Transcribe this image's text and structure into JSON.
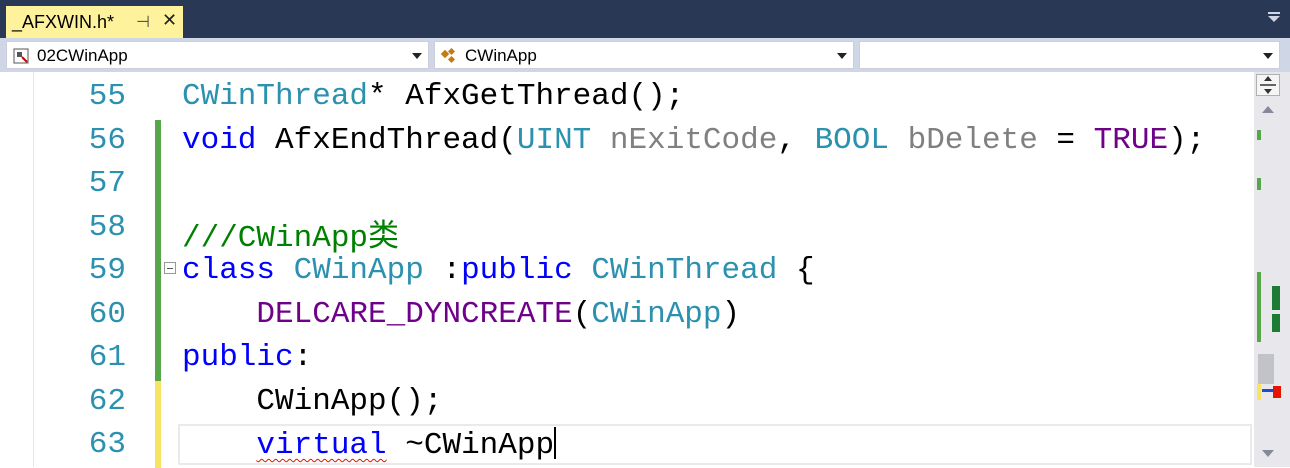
{
  "tab": {
    "title": "_AFXWIN.h*",
    "pin_glyph": "⊣",
    "close_glyph": "✕"
  },
  "nav": {
    "project_combo": "02CWinApp",
    "type_combo": "CWinApp",
    "member_combo": ""
  },
  "colors": {
    "tab_bg": "#fff29d",
    "tabstrip_bg": "#293955",
    "keyword": "#0000ff",
    "type": "#2b91af",
    "macro": "#6f008a",
    "comment": "#008000",
    "parameter": "#808080",
    "line_number": "#2b91af",
    "change_saved": "#57a64a",
    "change_unsaved": "#f7e463"
  },
  "lines": [
    {
      "number": "55",
      "change": "none",
      "outline": false,
      "tokens": [
        {
          "t": "CWinThread",
          "c": "type"
        },
        {
          "t": "* AfxGetThread();",
          "c": "plain"
        }
      ]
    },
    {
      "number": "56",
      "change": "saved",
      "outline": false,
      "tokens": [
        {
          "t": "void",
          "c": "keyword"
        },
        {
          "t": " AfxEndThread(",
          "c": "plain"
        },
        {
          "t": "UINT",
          "c": "type"
        },
        {
          "t": " ",
          "c": "plain"
        },
        {
          "t": "nExitCode",
          "c": "parameter"
        },
        {
          "t": ", ",
          "c": "plain"
        },
        {
          "t": "BOOL",
          "c": "type"
        },
        {
          "t": " ",
          "c": "plain"
        },
        {
          "t": "bDelete",
          "c": "parameter"
        },
        {
          "t": " = ",
          "c": "plain"
        },
        {
          "t": "TRUE",
          "c": "macro"
        },
        {
          "t": ");",
          "c": "plain"
        }
      ]
    },
    {
      "number": "57",
      "change": "saved",
      "outline": false,
      "tokens": []
    },
    {
      "number": "58",
      "change": "saved",
      "outline": false,
      "tokens": [
        {
          "t": "///CWinApp类",
          "c": "comment"
        }
      ]
    },
    {
      "number": "59",
      "change": "saved",
      "outline": true,
      "tokens": [
        {
          "t": "class",
          "c": "keyword"
        },
        {
          "t": " ",
          "c": "plain"
        },
        {
          "t": "CWinApp",
          "c": "type"
        },
        {
          "t": " :",
          "c": "plain"
        },
        {
          "t": "public",
          "c": "keyword"
        },
        {
          "t": " ",
          "c": "plain"
        },
        {
          "t": "CWinThread",
          "c": "type"
        },
        {
          "t": " {",
          "c": "plain"
        }
      ]
    },
    {
      "number": "60",
      "change": "saved",
      "outline": false,
      "tokens": [
        {
          "t": "    ",
          "c": "plain"
        },
        {
          "t": "DELCARE_DYNCREATE",
          "c": "macro"
        },
        {
          "t": "(",
          "c": "plain"
        },
        {
          "t": "CWinApp",
          "c": "type"
        },
        {
          "t": ")",
          "c": "plain"
        }
      ]
    },
    {
      "number": "61",
      "change": "saved",
      "outline": false,
      "tokens": [
        {
          "t": "public",
          "c": "keyword"
        },
        {
          "t": ":",
          "c": "plain"
        }
      ]
    },
    {
      "number": "62",
      "change": "unsaved",
      "outline": false,
      "tokens": [
        {
          "t": "    CWinApp();",
          "c": "plain"
        }
      ]
    },
    {
      "number": "63",
      "change": "unsaved",
      "outline": false,
      "current": true,
      "tokens": [
        {
          "t": "    ",
          "c": "plain"
        },
        {
          "t": "virtual",
          "c": "keyword",
          "squiggle": true
        },
        {
          "t": " ~CWinApp",
          "c": "plain"
        },
        {
          "t": "|caret|",
          "c": "caret"
        }
      ]
    }
  ]
}
